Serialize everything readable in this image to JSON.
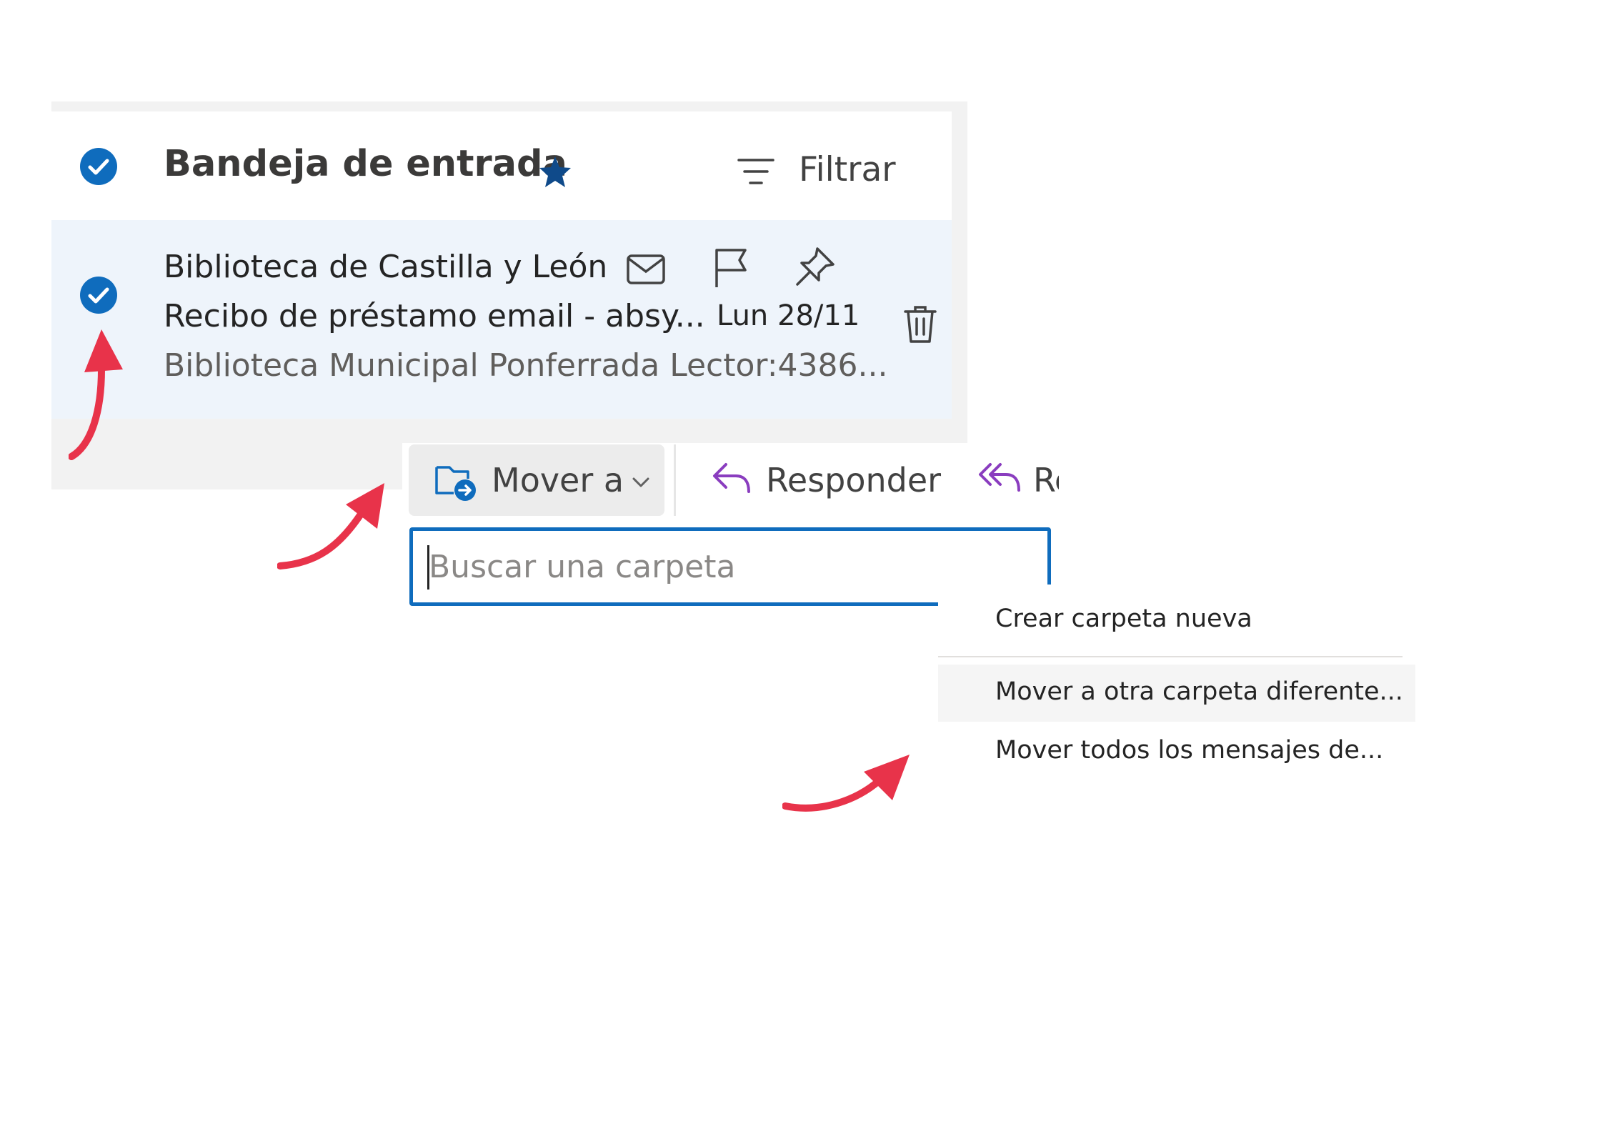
{
  "inbox": {
    "title": "Bandeja de entrada",
    "filter_label": "Filtrar"
  },
  "message": {
    "sender": "Biblioteca de Castilla y León",
    "subject": "Recibo de préstamo email - absy...",
    "date": "Lun 28/11",
    "preview": "Biblioteca Municipal Ponferrada Lector:4386..."
  },
  "ribbon": {
    "move_label": "Mover a",
    "reply_label": "Responder",
    "reply_all_label": "Re"
  },
  "folder_search": {
    "placeholder": "Buscar una carpeta"
  },
  "menu": {
    "items": [
      {
        "label": "Crear carpeta nueva"
      },
      {
        "label": "Mover a otra carpeta diferente..."
      },
      {
        "label": "Mover todos los mensajes de..."
      }
    ]
  },
  "colors": {
    "accent": "#0f6cbd",
    "arrow": "#e8334a",
    "reply_icon": "#8a3dbf"
  }
}
